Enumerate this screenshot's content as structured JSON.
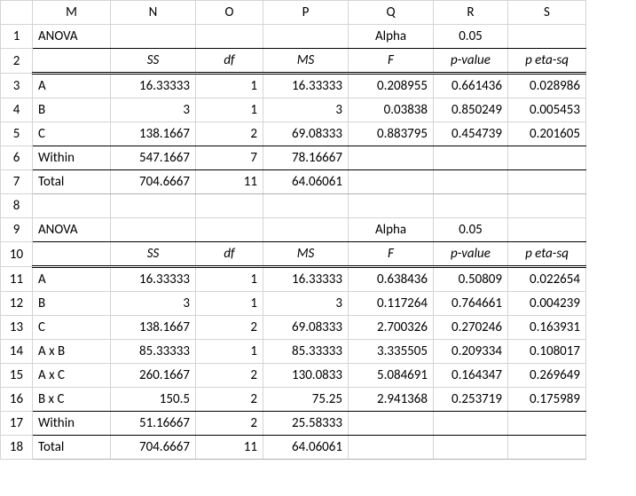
{
  "columns": [
    "M",
    "N",
    "O",
    "P",
    "Q",
    "R",
    "S"
  ],
  "rowNumbers": [
    1,
    2,
    3,
    4,
    5,
    6,
    7,
    8,
    9,
    10,
    11,
    12,
    13,
    14,
    15,
    16,
    17,
    18
  ],
  "labels": {
    "anova": "ANOVA",
    "alpha": "Alpha",
    "ss": "SS",
    "df": "df",
    "ms": "MS",
    "F": "F",
    "pvalue": "p-value",
    "peta": "p eta-sq",
    "A": "A",
    "B": "B",
    "C": "C",
    "AxB": "A x B",
    "AxC": "A x C",
    "BxC": "B x C",
    "within": "Within",
    "total": "Total"
  },
  "top": {
    "alpha": "0.05",
    "rows": {
      "A": {
        "ss": "16.33333",
        "df": "1",
        "ms": "16.33333",
        "F": "0.208955",
        "p": "0.661436",
        "eta": "0.028986"
      },
      "B": {
        "ss": "3",
        "df": "1",
        "ms": "3",
        "F": "0.03838",
        "p": "0.850249",
        "eta": "0.005453"
      },
      "C": {
        "ss": "138.1667",
        "df": "2",
        "ms": "69.08333",
        "F": "0.883795",
        "p": "0.454739",
        "eta": "0.201605"
      },
      "within": {
        "ss": "547.1667",
        "df": "7",
        "ms": "78.16667"
      },
      "total": {
        "ss": "704.6667",
        "df": "11",
        "ms": "64.06061"
      }
    }
  },
  "bottom": {
    "alpha": "0.05",
    "rows": {
      "A": {
        "ss": "16.33333",
        "df": "1",
        "ms": "16.33333",
        "F": "0.638436",
        "p": "0.50809",
        "eta": "0.022654"
      },
      "B": {
        "ss": "3",
        "df": "1",
        "ms": "3",
        "F": "0.117264",
        "p": "0.764661",
        "eta": "0.004239"
      },
      "C": {
        "ss": "138.1667",
        "df": "2",
        "ms": "69.08333",
        "F": "2.700326",
        "p": "0.270246",
        "eta": "0.163931"
      },
      "AxB": {
        "ss": "85.33333",
        "df": "1",
        "ms": "85.33333",
        "F": "3.335505",
        "p": "0.209334",
        "eta": "0.108017"
      },
      "AxC": {
        "ss": "260.1667",
        "df": "2",
        "ms": "130.0833",
        "F": "5.084691",
        "p": "0.164347",
        "eta": "0.269649"
      },
      "BxC": {
        "ss": "150.5",
        "df": "2",
        "ms": "75.25",
        "F": "2.941368",
        "p": "0.253719",
        "eta": "0.175989"
      },
      "within": {
        "ss": "51.16667",
        "df": "2",
        "ms": "25.58333"
      },
      "total": {
        "ss": "704.6667",
        "df": "11",
        "ms": "64.06061"
      }
    }
  }
}
